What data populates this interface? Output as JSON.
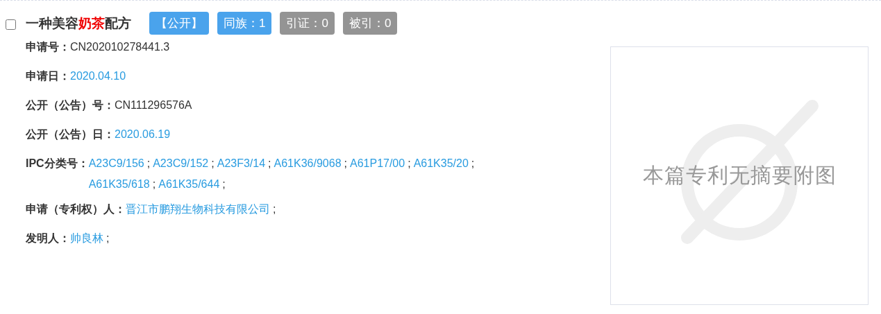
{
  "result": {
    "checked": false,
    "title": [
      {
        "text": "一种美容",
        "highlight": false
      },
      {
        "text": "奶茶",
        "highlight": true
      },
      {
        "text": "配方",
        "highlight": false
      }
    ],
    "badges": [
      {
        "label": "【公开】",
        "disabled": false
      },
      {
        "label": "同族：1",
        "disabled": false
      },
      {
        "label": "引证：0",
        "disabled": true
      },
      {
        "label": "被引：0",
        "disabled": true
      }
    ],
    "fields": [
      {
        "label": "申请号：",
        "values": [
          {
            "text": "CN202010278441.3",
            "link": false
          }
        ]
      },
      {
        "label": "申请日：",
        "values": [
          {
            "text": "2020.04.10",
            "link": true
          }
        ]
      },
      {
        "label": "公开（公告）号：",
        "values": [
          {
            "text": "CN111296576A",
            "link": false
          }
        ]
      },
      {
        "label": "公开（公告）日：",
        "values": [
          {
            "text": "2020.06.19",
            "link": true
          }
        ]
      },
      {
        "label": "IPC分类号：",
        "values": [
          {
            "text": "A23C9/156",
            "link": true,
            "sep": ";"
          },
          {
            "text": "A23C9/152",
            "link": true,
            "sep": ";"
          },
          {
            "text": "A23F3/14",
            "link": true,
            "sep": ";"
          },
          {
            "text": "A61K36/9068",
            "link": true,
            "sep": ";"
          },
          {
            "text": "A61P17/00",
            "link": true,
            "sep": ";"
          },
          {
            "text": "A61K35/20",
            "link": true,
            "sep": ";"
          },
          {
            "text": "A61K35/618",
            "link": true,
            "sep": ";"
          },
          {
            "text": "A61K35/644",
            "link": true,
            "sep": ";"
          }
        ]
      },
      {
        "label": "申请（专利权）人：",
        "values": [
          {
            "text": "晋江市鹏翔生物科技有限公司",
            "link": true,
            "sep": ";"
          }
        ]
      },
      {
        "label": "发明人：",
        "values": [
          {
            "text": "帅良林",
            "link": true,
            "sep": ";"
          }
        ]
      }
    ],
    "figure": {
      "placeholder": "本篇专利无摘要附图"
    }
  }
}
